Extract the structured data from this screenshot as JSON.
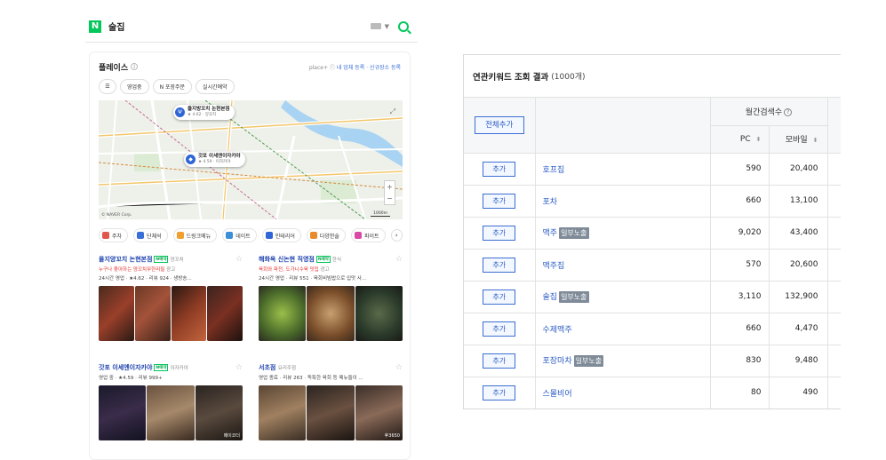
{
  "naver": {
    "query": "술집",
    "logo": "N",
    "search_icon": "search-icon",
    "places": {
      "title": "플레이스",
      "brand": "place+",
      "register_link": "내 업체 등록",
      "new_place_link": "신규장소 등록",
      "chips": [
        "영업중",
        "N 포장주문",
        "실시간예약"
      ],
      "map": {
        "pin1_name": "을지방꼬치 논현본점",
        "pin1_sub": "★ 4.62 · 양꼬치",
        "pin2_name": "갓포 이세엔이자카야",
        "pin2_sub": "★ 4.59 · 이자카야",
        "copyright": "© NAVER Corp.",
        "scale": "1000m",
        "zoom_in": "+",
        "zoom_out": "−"
      },
      "categories": [
        "주차",
        "단체석",
        "드링크메뉴",
        "데이트",
        "인테리어",
        "다양한술",
        "파이트"
      ],
      "items": [
        {
          "name": "을지양꼬치 논현본점",
          "badge": "N예약",
          "category": "양꼬치",
          "promo": "누구나 좋아하는 양꼬치무한리필",
          "ad": "광고",
          "meta": "24시간 영업 · ★4.62 · 리뷰 924 · 생방송..."
        },
        {
          "name": "해화옥 신논현 직영점",
          "badge": "N예약",
          "category": "한식",
          "promo": "육회와 파전, 도가니수육 맛집",
          "ad": "광고",
          "meta": "24시간 영업 · 리뷰 551 · 육회비빔밥으로 입맛 사..."
        },
        {
          "name": "갓포 이세엔이자카야",
          "badge": "N예약",
          "category": "이자카야",
          "promo": "",
          "ad": "",
          "meta": "영업 중 · ★4.59 · 리뷰 999+"
        },
        {
          "name": "서초점",
          "badge": "",
          "category": "요리주점",
          "promo": "",
          "ad": "",
          "meta": "영업 종료 · 리뷰 263 · 독특한 육회 등 메뉴들이 ..."
        }
      ],
      "photo_tags": [
        "메이코더",
        "후3650"
      ]
    }
  },
  "keyword_panel": {
    "title": "연관키워드 조회 결과",
    "count": "(1000개)",
    "select_all_label": "전체추가",
    "monthly_search_header": "월간검색수",
    "pc_header": "PC",
    "mobile_header": "모바일",
    "add_label": "추가",
    "exposure_label": "일부노출",
    "rows": [
      {
        "keyword": "호프집",
        "partial": false,
        "pc": "590",
        "mobile": "20,400"
      },
      {
        "keyword": "포차",
        "partial": false,
        "pc": "660",
        "mobile": "13,100"
      },
      {
        "keyword": "맥주",
        "partial": true,
        "pc": "9,020",
        "mobile": "43,400"
      },
      {
        "keyword": "맥주집",
        "partial": false,
        "pc": "570",
        "mobile": "20,600"
      },
      {
        "keyword": "술집",
        "partial": true,
        "pc": "3,110",
        "mobile": "132,900"
      },
      {
        "keyword": "수제맥주",
        "partial": false,
        "pc": "660",
        "mobile": "4,470"
      },
      {
        "keyword": "포장마차",
        "partial": true,
        "pc": "830",
        "mobile": "9,480"
      },
      {
        "keyword": "스몰비어",
        "partial": false,
        "pc": "80",
        "mobile": "490"
      }
    ]
  },
  "colors": {
    "naver_green": "#03c75a",
    "link_blue": "#2a5bc4",
    "badge_gray": "#7f8b98",
    "promo_red": "#e5322d"
  }
}
